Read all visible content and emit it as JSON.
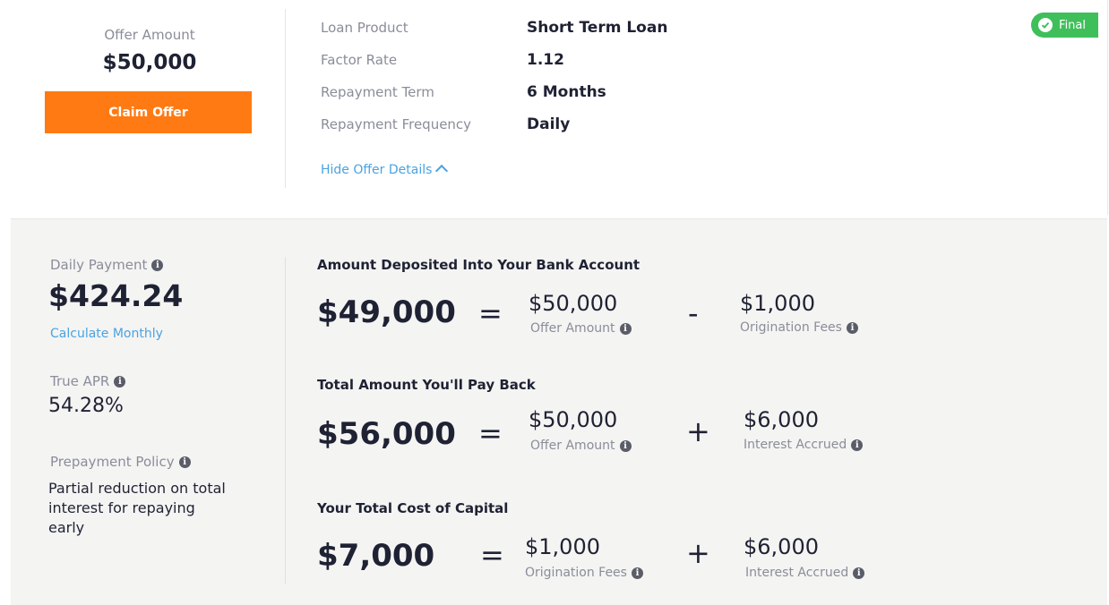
{
  "offer": {
    "label": "Offer Amount",
    "amount": "$50,000",
    "claim_label": "Claim Offer",
    "badge": "Final",
    "details": [
      {
        "label": "Loan Product",
        "value": "Short Term Loan"
      },
      {
        "label": "Factor Rate",
        "value": "1.12"
      },
      {
        "label": "Repayment Term",
        "value": "6 Months"
      },
      {
        "label": "Repayment Frequency",
        "value": "Daily"
      }
    ],
    "hide_details_label": "Hide Offer Details"
  },
  "summary": {
    "daily_payment_label": "Daily Payment",
    "daily_payment": "$424.24",
    "calculate_monthly": "Calculate Monthly",
    "true_apr_label": "True APR",
    "true_apr": "54.28%",
    "prepayment_label": "Prepayment Policy",
    "prepayment_text": "Partial reduction on total interest for repaying early"
  },
  "breakdown": {
    "deposited": {
      "title": "Amount Deposited Into Your Bank Account",
      "total": "$49,000",
      "eq": "=",
      "a_value": "$50,000",
      "a_label": "Offer Amount",
      "op": "-",
      "b_value": "$1,000",
      "b_label": "Origination Fees"
    },
    "payback": {
      "title": "Total Amount You'll Pay Back",
      "total": "$56,000",
      "eq": "=",
      "a_value": "$50,000",
      "a_label": "Offer Amount",
      "op": "+",
      "b_value": "$6,000",
      "b_label": "Interest Accrued"
    },
    "cost": {
      "title": "Your Total Cost of Capital",
      "total": "$7,000",
      "eq": "=",
      "a_value": "$1,000",
      "a_label": "Origination Fees",
      "op": "+",
      "b_value": "$6,000",
      "b_label": "Interest Accrued"
    }
  },
  "colors": {
    "accent_orange": "#ff7a12",
    "badge_green": "#3fbf5a",
    "link_blue": "#4aa3e0"
  },
  "icons": [
    "check-icon",
    "chevron-up-icon",
    "info-icon"
  ]
}
